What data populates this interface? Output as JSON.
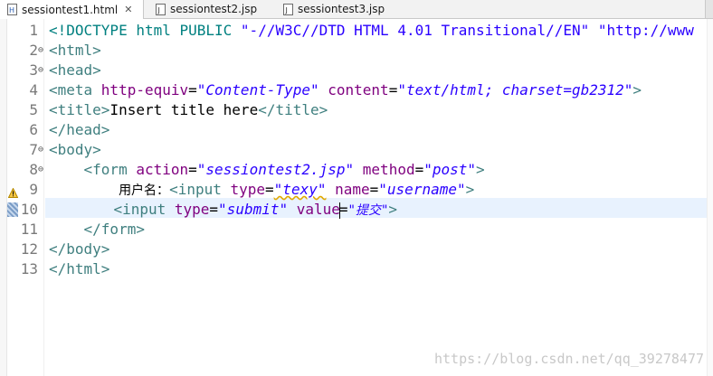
{
  "tabs": [
    {
      "label": "sessiontest1.html",
      "close": "✕",
      "icon": "html-file-icon"
    },
    {
      "label": "sessiontest2.jsp",
      "icon": "jsp-file-icon"
    },
    {
      "label": "sessiontest3.jsp",
      "icon": "jsp-file-icon"
    }
  ],
  "editor": {
    "line_numbers": [
      "1",
      "2",
      "3",
      "4",
      "5",
      "6",
      "7",
      "8",
      "9",
      "10",
      "11",
      "12",
      "13"
    ],
    "fold_markers": {
      "l2": "⊖",
      "l3": "⊖",
      "l7": "⊖",
      "l8": "⊖"
    },
    "lines": {
      "l1": {
        "a": "<!DOCTYPE html PUBLIC ",
        "b": "\"-//W3C//DTD HTML 4.01 Transitional//EN\" \"http://www"
      },
      "l2": {
        "a": "<html>"
      },
      "l3": {
        "a": "<head>"
      },
      "l4": {
        "a": "<meta ",
        "b": "http-equiv",
        "c": "=",
        "d": "\"Content-Type\"",
        "e": " content",
        "f": "=",
        "g": "\"text/html; charset=gb2312\"",
        "h": ">"
      },
      "l5": {
        "a": "<title>",
        "b": "Insert title here",
        "c": "</title>"
      },
      "l6": {
        "a": "</head>"
      },
      "l7": {
        "a": "<body>"
      },
      "l8": {
        "indent": "    ",
        "a": "<form ",
        "b": "action",
        "c": "=",
        "d": "\"sessiontest2.jsp\"",
        "e": " method",
        "f": "=",
        "g": "\"post\"",
        "h": ">"
      },
      "l9": {
        "indent": "        ",
        "pre": "用户名：",
        "a": "<input ",
        "b": "type",
        "c": "=",
        "d": "\"texy\"",
        "e": " name",
        "f": "=",
        "g": "\"username\"",
        "h": ">"
      },
      "l10": {
        "indent": "       ",
        "a": "<input ",
        "b": "type",
        "c": "=",
        "d": "\"submit\"",
        "e": " value",
        "f": "=",
        "g": "\"提交\"",
        "h": ">"
      },
      "l11": {
        "indent": "    ",
        "a": "</form>"
      },
      "l12": {
        "a": "</body>"
      },
      "l13": {
        "a": "</html>"
      }
    }
  },
  "watermark": "https://blog.csdn.net/qq_39278477",
  "colors": {
    "tag": "#3f7f7f",
    "attr": "#7f007f",
    "value": "#2a00ff",
    "current_line": "#e8f2fe"
  }
}
